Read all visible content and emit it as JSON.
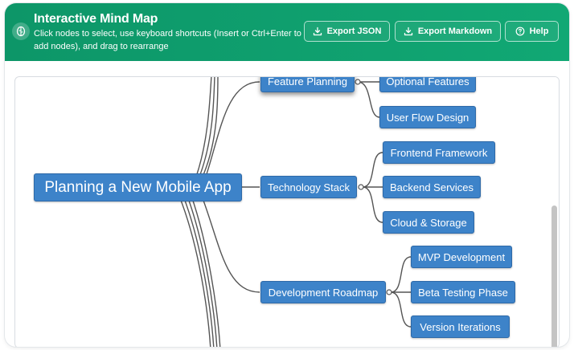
{
  "app": {
    "title": "Interactive Mind Map",
    "subtitle": "Click nodes to select, use keyboard shortcuts (Insert or Ctrl+Enter to add nodes), and drag to rearrange"
  },
  "toolbar": {
    "export_json": "Export JSON",
    "export_markdown": "Export Markdown",
    "help": "Help"
  },
  "colors": {
    "header": "#0d9668",
    "node_fill": "#3d83c9",
    "link": "#555555"
  },
  "icons": {
    "logo": "brain-icon",
    "export_json": "download-icon",
    "export_markdown": "download-icon",
    "help": "question-circle-icon"
  },
  "mindmap": {
    "root": "Planning a New Mobile App",
    "branches": [
      {
        "label": "Feature Planning",
        "children": [
          "Optional Features",
          "User Flow Design"
        ]
      },
      {
        "label": "Technology Stack",
        "children": [
          "Frontend Framework",
          "Backend Services",
          "Cloud & Storage"
        ]
      },
      {
        "label": "Development Roadmap",
        "children": [
          "MVP Development",
          "Beta Testing Phase",
          "Version Iterations"
        ]
      }
    ]
  }
}
